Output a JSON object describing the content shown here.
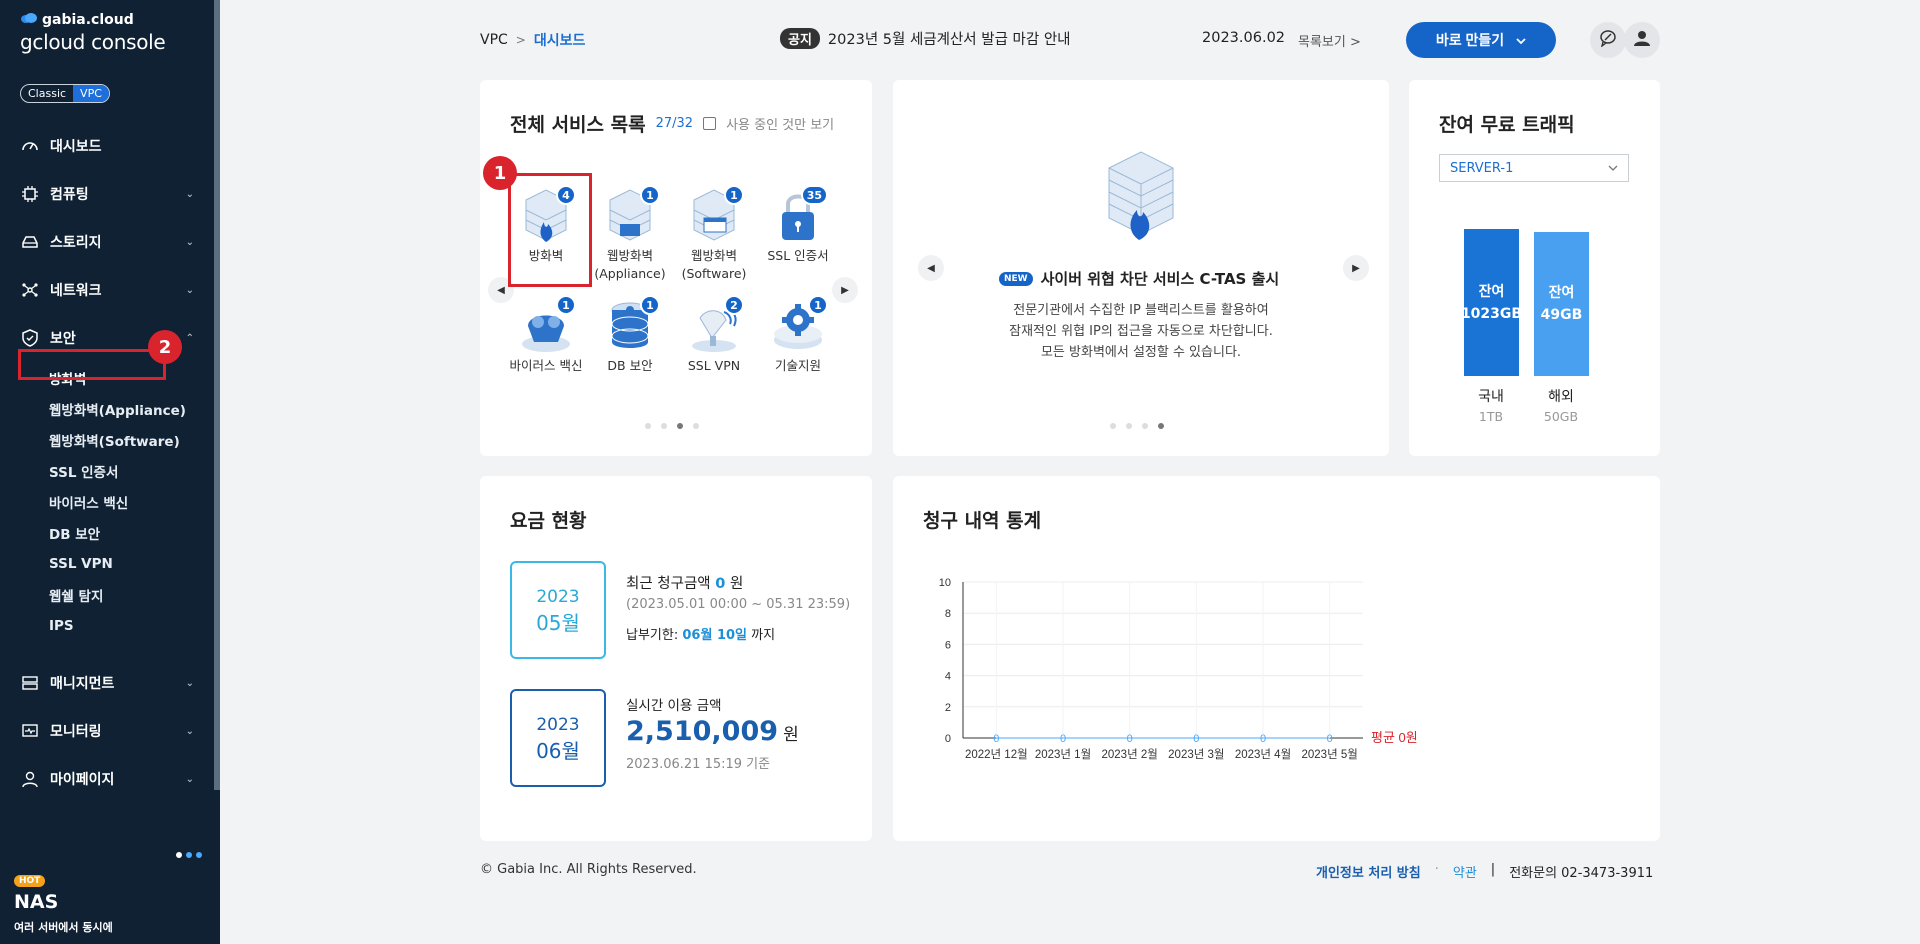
{
  "sidebar": {
    "brand_top": "gabia.cloud",
    "brand_main": "gcloud console",
    "toggle": [
      "Classic",
      "VPC"
    ],
    "menu": [
      {
        "label": "대시보드",
        "icon": "dashboard-icon"
      },
      {
        "label": "컴퓨팅",
        "icon": "chip-icon"
      },
      {
        "label": "스토리지",
        "icon": "storage-icon"
      },
      {
        "label": "네트워크",
        "icon": "network-icon"
      },
      {
        "label": "보안",
        "icon": "shield-icon"
      }
    ],
    "security_sub": [
      "방화벽",
      "웹방화벽(Appliance)",
      "웹방화벽(Software)",
      "SSL 인증서",
      "바이러스 백신",
      "DB 보안",
      "SSL VPN",
      "웹쉘 탐지",
      "IPS"
    ],
    "menu_bottom": [
      {
        "label": "매니지먼트",
        "icon": "server-icon"
      },
      {
        "label": "모니터링",
        "icon": "monitor-icon"
      },
      {
        "label": "마이페이지",
        "icon": "user-icon"
      }
    ],
    "promo": {
      "hot": "HOT",
      "title": "NAS",
      "desc": "여러 서버에서 동시에"
    }
  },
  "annotations": {
    "one": "1",
    "two": "2"
  },
  "header": {
    "breadcrumb_root": "VPC",
    "breadcrumb_sep": ">",
    "breadcrumb_current": "대시보드",
    "notice_tag": "공지",
    "notice_text": "2023년 5월 세금계산서 발급 마감 안내",
    "notice_date": "2023.06.02",
    "notice_more": "목록보기 >",
    "make_button": "바로 만들기"
  },
  "services": {
    "title": "전체 서비스 목록",
    "count": "27/32",
    "only_in_use": "사용 중인 것만 보기",
    "items": [
      {
        "label": "방화벽",
        "badge": "4"
      },
      {
        "label": "웹방화벽\n(Appliance)",
        "badge": "1"
      },
      {
        "label": "웹방화벽\n(Software)",
        "badge": "1"
      },
      {
        "label": "SSL 인증서",
        "badge": "35"
      },
      {
        "label": "바이러스 백신",
        "badge": "1"
      },
      {
        "label": "DB 보안",
        "badge": "1"
      },
      {
        "label": "SSL VPN",
        "badge": "2"
      },
      {
        "label": "기술지원",
        "badge": "1"
      }
    ]
  },
  "banner": {
    "new_tag": "NEW",
    "title": "사이버 위협 차단 서비스 C-TAS 출시",
    "desc": [
      "전문기관에서 수집한 IP 블랙리스트를 활용하여",
      "잠재적인 위협 IP의 접근을 자동으로 차단합니다.",
      "모든 방화벽에서 설정할 수 있습니다."
    ]
  },
  "traffic": {
    "title": "잔여 무료 트래픽",
    "server_select": "SERVER-1",
    "bars": [
      {
        "label": "국내",
        "total": "1TB",
        "remaining_label": "잔여",
        "remaining_value": "1023GB",
        "remaining_fraction": 0.999,
        "color": "#1a74d6"
      },
      {
        "label": "해외",
        "total": "50GB",
        "remaining_label": "잔여",
        "remaining_value": "49GB",
        "remaining_fraction": 0.98,
        "color": "#4aa0f0"
      }
    ]
  },
  "fees": {
    "title": "요금 현황",
    "recent": {
      "year": "2023",
      "month": "05월",
      "label": "최근 청구금액",
      "amount": "0",
      "unit": "원",
      "period": "(2023.05.01 00:00 ~ 05.31 23:59)",
      "due_label": "납부기한:",
      "due_date": "06월 10일",
      "due_suffix": "까지"
    },
    "realtime": {
      "year": "2023",
      "month": "06월",
      "label": "실시간 이용 금액",
      "amount": "2,510,009",
      "unit": "원",
      "basis": "2023.06.21 15:19 기준"
    }
  },
  "billing": {
    "title": "청구 내역 통계",
    "avg_label": "평균 0원"
  },
  "chart_data": {
    "type": "line",
    "categories": [
      "2022년 12월",
      "2023년 1월",
      "2023년 2월",
      "2023년 3월",
      "2023년 4월",
      "2023년 5월"
    ],
    "values": [
      0,
      0,
      0,
      0,
      0,
      0
    ],
    "ylim": [
      0,
      10
    ],
    "yticks": [
      0,
      2,
      4,
      6,
      8,
      10
    ],
    "grid": true
  },
  "footer": {
    "copyright": "© Gabia Inc. All Rights Reserved.",
    "privacy": "개인정보 처리 방침",
    "dot": "·",
    "terms": "약관",
    "bar": "|",
    "phone": "전화문의  02-3473-3911"
  }
}
